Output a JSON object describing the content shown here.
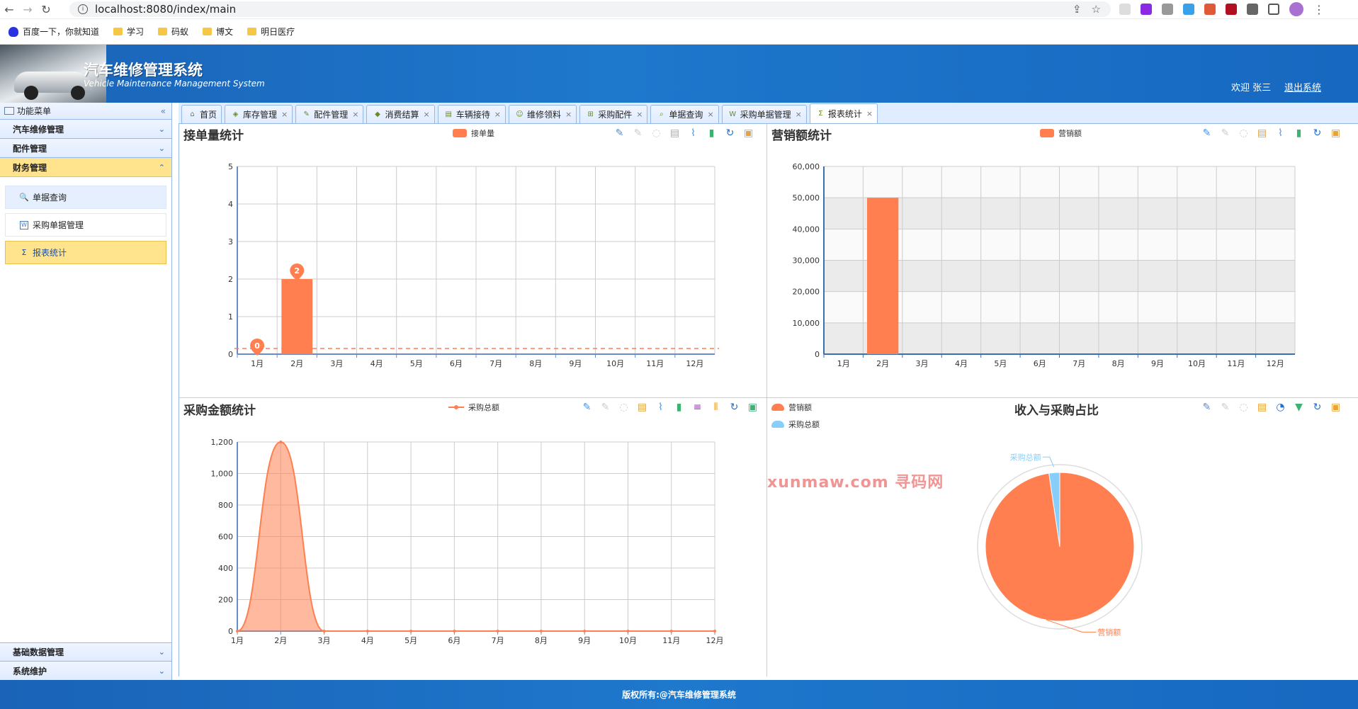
{
  "browser": {
    "url": "localhost:8080/index/main",
    "bookmarks": [
      "百度一下，你就知道",
      "学习",
      "码蚁",
      "博文",
      "明日医疗"
    ]
  },
  "header": {
    "title": "汽车维修管理系统",
    "subtitle": "Vehicle Maintenance Management System",
    "welcome": "欢迎 张三",
    "logout": "退出系统"
  },
  "sidebar": {
    "title": "功能菜单",
    "groups": [
      "汽车维修管理",
      "配件管理",
      "财务管理"
    ],
    "active_group": "财务管理",
    "items": [
      "单据查询",
      "采购单据管理",
      "报表统计"
    ],
    "selected_item": "报表统计",
    "bottom_groups": [
      "基础数据管理",
      "系统维护"
    ]
  },
  "tabs": [
    {
      "label": "首页",
      "icon": "home-icon"
    },
    {
      "label": "库存管理",
      "icon": "shield-icon"
    },
    {
      "label": "配件管理",
      "icon": "pencil-icon"
    },
    {
      "label": "消费结算",
      "icon": "tag-icon"
    },
    {
      "label": "车辆接待",
      "icon": "car-icon"
    },
    {
      "label": "维修领料",
      "icon": "person-icon"
    },
    {
      "label": "采购配件",
      "icon": "cart-icon"
    },
    {
      "label": "单据查询",
      "icon": "search-icon"
    },
    {
      "label": "采购单据管理",
      "icon": "doc-icon"
    },
    {
      "label": "报表统计",
      "icon": "sigma-icon"
    }
  ],
  "charts": {
    "orders": {
      "title": "接单量统计",
      "legend": "接单量"
    },
    "sales": {
      "title": "营销额统计",
      "legend": "营销额"
    },
    "purchase": {
      "title": "采购金额统计",
      "legend": "采购总额"
    },
    "ratio": {
      "title": "收入与采购占比",
      "legend_sales": "营销额",
      "legend_purchase": "采购总额"
    }
  },
  "chart_data": [
    {
      "type": "bar",
      "title": "接单量统计",
      "categories": [
        "1月",
        "2月",
        "3月",
        "4月",
        "5月",
        "6月",
        "7月",
        "8月",
        "9月",
        "10月",
        "11月",
        "12月"
      ],
      "series": [
        {
          "name": "接单量",
          "values": [
            0,
            2,
            0,
            0,
            0,
            0,
            0,
            0,
            0,
            0,
            0,
            0
          ]
        }
      ],
      "markpoints": [
        0,
        2
      ],
      "ylim": [
        0,
        5
      ],
      "yticks": [
        "0",
        "1",
        "2",
        "3",
        "4",
        "5"
      ],
      "grid": true,
      "color": "#ff7f50"
    },
    {
      "type": "bar",
      "title": "营销额统计",
      "categories": [
        "1月",
        "2月",
        "3月",
        "4月",
        "5月",
        "6月",
        "7月",
        "8月",
        "9月",
        "10月",
        "11月",
        "12月"
      ],
      "series": [
        {
          "name": "营销额",
          "values": [
            0,
            50000,
            0,
            0,
            0,
            0,
            0,
            0,
            0,
            0,
            0,
            0
          ]
        }
      ],
      "ylim": [
        0,
        60000
      ],
      "yticks": [
        "0",
        "10,000",
        "20,000",
        "30,000",
        "40,000",
        "50,000",
        "60,000"
      ],
      "grid": true,
      "color": "#ff7f50"
    },
    {
      "type": "area",
      "title": "采购金额统计",
      "categories": [
        "1月",
        "2月",
        "3月",
        "4月",
        "5月",
        "6月",
        "7月",
        "8月",
        "9月",
        "10月",
        "11月",
        "12月"
      ],
      "series": [
        {
          "name": "采购总额",
          "values": [
            0,
            1200,
            0,
            0,
            0,
            0,
            0,
            0,
            0,
            0,
            0,
            0
          ]
        }
      ],
      "ylim": [
        0,
        1200
      ],
      "yticks": [
        "0",
        "200",
        "400",
        "600",
        "800",
        "1,000",
        "1,200"
      ],
      "grid": true,
      "color": "#ff7f50"
    },
    {
      "type": "pie",
      "title": "收入与采购占比",
      "slices": [
        {
          "name": "营销额",
          "value": 50000,
          "color": "#ff7f50"
        },
        {
          "name": "采购总额",
          "value": 1200,
          "color": "#87cefa"
        }
      ]
    }
  ],
  "watermark": "xunmaw.com 寻码网",
  "footer": "版权所有:@汽车维修管理系统"
}
